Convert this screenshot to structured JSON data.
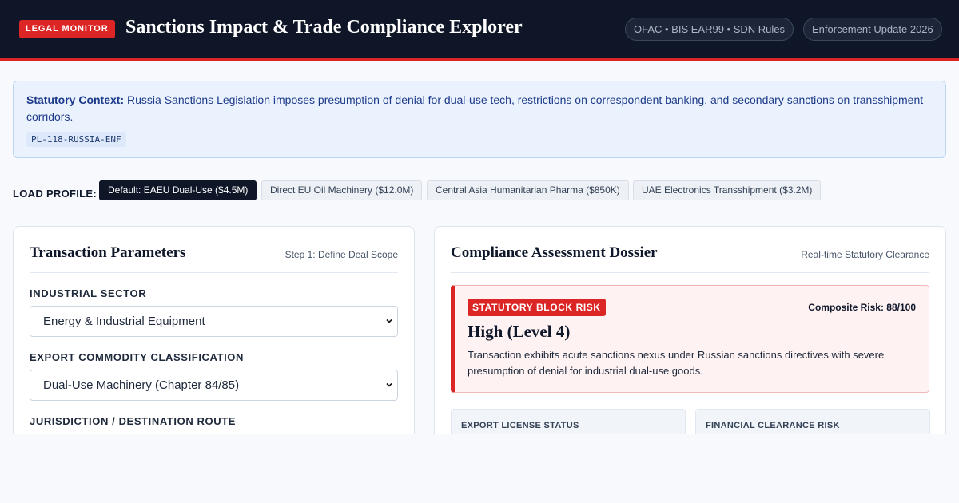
{
  "header": {
    "badge": "LEGAL MONITOR",
    "title": "Sanctions Impact & Trade Compliance Explorer",
    "pills": [
      "OFAC • BIS EAR99 • SDN Rules",
      "Enforcement Update 2026"
    ]
  },
  "context": {
    "label": "Statutory Context:",
    "text": "Russia Sanctions Legislation imposes presumption of denial for dual-use tech, restrictions on correspondent banking, and secondary sanctions on transshipment corridors.",
    "code": "PL-118-RUSSIA-ENF"
  },
  "profiles": {
    "label": "LOAD PROFILE:",
    "items": [
      {
        "label": "Default: EAEU Dual-Use ($4.5M)",
        "active": true
      },
      {
        "label": "Direct EU Oil Machinery ($12.0M)",
        "active": false
      },
      {
        "label": "Central Asia Humanitarian Pharma ($850K)",
        "active": false
      },
      {
        "label": "UAE Electronics Transshipment ($3.2M)",
        "active": false
      }
    ]
  },
  "transaction": {
    "title": "Transaction Parameters",
    "step": "Step 1: Define Deal Scope",
    "sector_label": "INDUSTRIAL SECTOR",
    "sector_value": "Energy & Industrial Equipment",
    "commodity_label": "EXPORT COMMODITY CLASSIFICATION",
    "commodity_value": "Dual-Use Machinery (Chapter 84/85)",
    "jurisdiction_label": "JURISDICTION / DESTINATION ROUTE"
  },
  "dossier": {
    "title": "Compliance Assessment Dossier",
    "subtitle": "Real-time Statutory Clearance",
    "risk_badge": "STATUTORY BLOCK RISK",
    "risk_score": "Composite Risk: 88/100",
    "risk_level": "High (Level 4)",
    "risk_desc": "Transaction exhibits acute sanctions nexus under Russian sanctions directives with severe presumption of denial for industrial dual-use goods.",
    "export_label": "EXPORT LICENSE STATUS",
    "finance_label": "FINANCIAL CLEARANCE RISK"
  },
  "colors": {
    "header_bg": "#0e1628",
    "accent_red": "#dc2626",
    "context_bg": "#eaf2fe"
  },
  "icons": [
    "chevron-down-icon"
  ]
}
